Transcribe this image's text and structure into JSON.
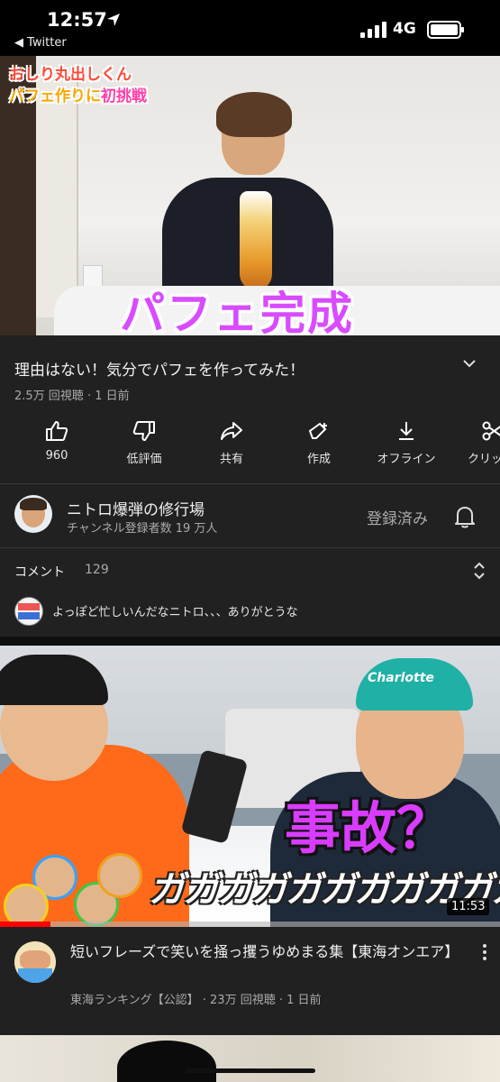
{
  "status_bar": {
    "time": "12:57",
    "back_label": "◀ Twitter",
    "network": "4G"
  },
  "player": {
    "caption_line1": "おしり丸出しくん",
    "caption_line2_a": "パフェ作りに",
    "caption_line2_b": "初挑戦",
    "overlay_text": "パフェ完成"
  },
  "video": {
    "title": "理由はない！気分でパフェを作ってみた！",
    "views_line": "2.5万 回視聴 · 1 日前"
  },
  "actions": [
    {
      "label": "960",
      "icon": "thumbs-up-icon"
    },
    {
      "label": "低評価",
      "icon": "thumbs-down-icon"
    },
    {
      "label": "共有",
      "icon": "share-icon"
    },
    {
      "label": "作成",
      "icon": "remix-icon"
    },
    {
      "label": "オフライン",
      "icon": "download-icon"
    },
    {
      "label": "クリップ",
      "icon": "clip-icon"
    }
  ],
  "channel": {
    "name": "ニトロ爆弾の修行場",
    "subscribers": "チャンネル登録者数 19 万人",
    "subscribed_label": "登録済み"
  },
  "comments": {
    "label": "コメント",
    "count": "129",
    "top_comment": "よっぽど忙しいんだなニトロ、、、ありがとうな"
  },
  "next_video": {
    "overlay_main": "事故？",
    "overlay_sound": "ガガガガガガガガガガガ",
    "hat_text": "Charlotte",
    "duration": "11:53",
    "progress": 0.1,
    "title": "短いフレーズで笑いを掻っ攫うゆめまる集【東海オンエア】",
    "channel": "東海ランキング【公認】",
    "meta": "· 23万 回視聴 · 1 日前"
  },
  "colors": {
    "accent_red": "#ff0000",
    "caption_purple": "#d84bff",
    "panel": "#212121"
  }
}
